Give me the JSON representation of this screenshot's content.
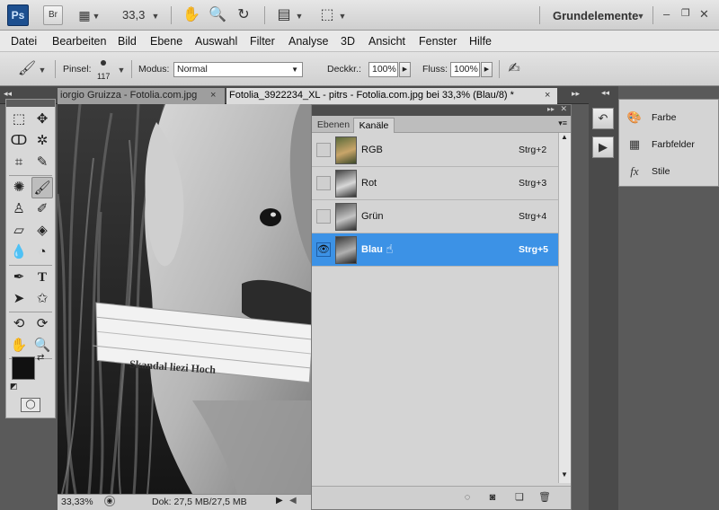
{
  "app": {
    "logo": "Ps",
    "bridge": "Br",
    "zoom": "33,3",
    "workspace": "Grundelemente",
    "icons": [
      "screen-mode-icon",
      "hand-icon",
      "zoom-icon",
      "rotate-view-icon",
      "arrange-documents-icon",
      "screen-mode-frame-icon"
    ]
  },
  "menu": [
    "Datei",
    "Bearbeiten",
    "Bild",
    "Ebene",
    "Auswahl",
    "Filter",
    "Analyse",
    "3D",
    "Ansicht",
    "Fenster",
    "Hilfe"
  ],
  "options": {
    "brush_label": "Pinsel:",
    "brush_size": "117",
    "mode_label": "Modus:",
    "mode_value": "Normal",
    "opacity_label": "Deckkr.:",
    "opacity_value": "100%",
    "flow_label": "Fluss:",
    "flow_value": "100%"
  },
  "tabs": [
    {
      "label": "iorgio Gruizza - Fotolia.com.jpg",
      "close": "×"
    },
    {
      "label": "Fotolia_3922234_XL - pitrs - Fotolia.com.jpg bei 33,3% (Blau/8) *",
      "close": "×"
    }
  ],
  "collapse": {
    "left": "◂◂",
    "right": "▸▸",
    "dock": "◂◂",
    "panel": "▸▸"
  },
  "canvas": {
    "newspaper_text": "Skandal liezi Hoch"
  },
  "status": {
    "zoom": "33,33%",
    "doc": "Dok: 27,5 MB/27,5 MB"
  },
  "panel": {
    "tabs": [
      "Ebenen",
      "Kanäle"
    ],
    "channels": [
      {
        "name": "RGB",
        "shortcut": "Strg+2",
        "visible": false,
        "selected": false
      },
      {
        "name": "Rot",
        "shortcut": "Strg+3",
        "visible": false,
        "selected": false
      },
      {
        "name": "Grün",
        "shortcut": "Strg+4",
        "visible": false,
        "selected": false
      },
      {
        "name": "Blau",
        "shortcut": "Strg+5",
        "visible": true,
        "selected": true
      }
    ],
    "footer_icons": [
      "load-selection-icon",
      "save-selection-icon",
      "new-channel-icon",
      "delete-channel-icon"
    ]
  },
  "dock": {
    "items": [
      {
        "label": "Farbe",
        "icon": "palette-icon"
      },
      {
        "label": "Farbfelder",
        "icon": "swatches-icon"
      },
      {
        "label": "Stile",
        "icon": "styles-icon"
      }
    ]
  },
  "colors": {
    "selection": "#3c92e6",
    "app_bg": "#5a5a5a",
    "panel_bg": "#d4d4d4"
  }
}
